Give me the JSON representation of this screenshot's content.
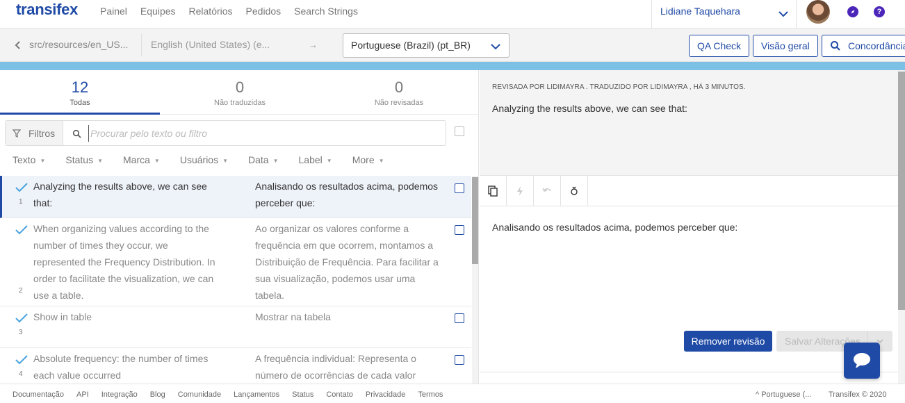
{
  "nav": {
    "logo": "transifex",
    "links": [
      "Painel",
      "Equipes",
      "Relatórios",
      "Pedidos",
      "Search Strings"
    ],
    "user_name": "Lidiane Taquehara",
    "help_glyph": "?",
    "accent_color": "#1f4aa6"
  },
  "toolbar": {
    "resource_path": "src/resources/en_US...",
    "source_language": "English (United States) (e...",
    "arrow": "→",
    "target_language": "Portuguese (Brazil) (pt_BR)",
    "qa_check": "QA Check",
    "overview": "Visão geral",
    "concordance": "Concordância"
  },
  "stats": [
    {
      "count": "12",
      "label": "Todas"
    },
    {
      "count": "0",
      "label": "Não traduzidas"
    },
    {
      "count": "0",
      "label": "Não revisadas"
    }
  ],
  "filters": {
    "button_label": "Filtros",
    "search_placeholder": "Procurar pelo texto ou filtro",
    "facets": [
      "Texto",
      "Status",
      "Marca",
      "Usuários",
      "Data",
      "Label",
      "More"
    ]
  },
  "strings": [
    {
      "number": "1",
      "source": "Analyzing the results above, we can see that:",
      "translation": "Analisando os resultados acima, podemos perceber que:"
    },
    {
      "number": "2",
      "source": "When organizing values according to the number of times they occur, we represented the Frequency Distribution. In order to facilitate the visualization, we can use a table.",
      "translation": "Ao organizar os valores conforme a frequência em que ocorrem, montamos a Distribuição de Frequência. Para facilitar a sua visualização, podemos usar uma tabela."
    },
    {
      "number": "3",
      "source": "Show in table",
      "translation": "Mostrar na tabela"
    },
    {
      "number": "4",
      "source": "Absolute frequency: the number of times each value occurred",
      "translation": "A frequência individual: Representa o número de ocorrências de cada valor"
    }
  ],
  "detail": {
    "meta": "REVISADA POR LIDIMAYRA . TRADUZIDO POR LIDIMAYRA , HÁ 3 MINUTOS.",
    "source_text": "Analyzing the results above, we can see that:",
    "translation_text": "Analisando os resultados acima, podemos perceber que:",
    "remove_review": "Remover revisão",
    "save_changes": "Salvar Alterações"
  },
  "footer": {
    "links": [
      "Documentação",
      "API",
      "Integração",
      "Blog",
      "Comunidade",
      "Lançamentos",
      "Status",
      "Contato",
      "Privacidade",
      "Termos"
    ],
    "language": "^ Portuguese (...",
    "copyright": "Transifex © 2020"
  }
}
